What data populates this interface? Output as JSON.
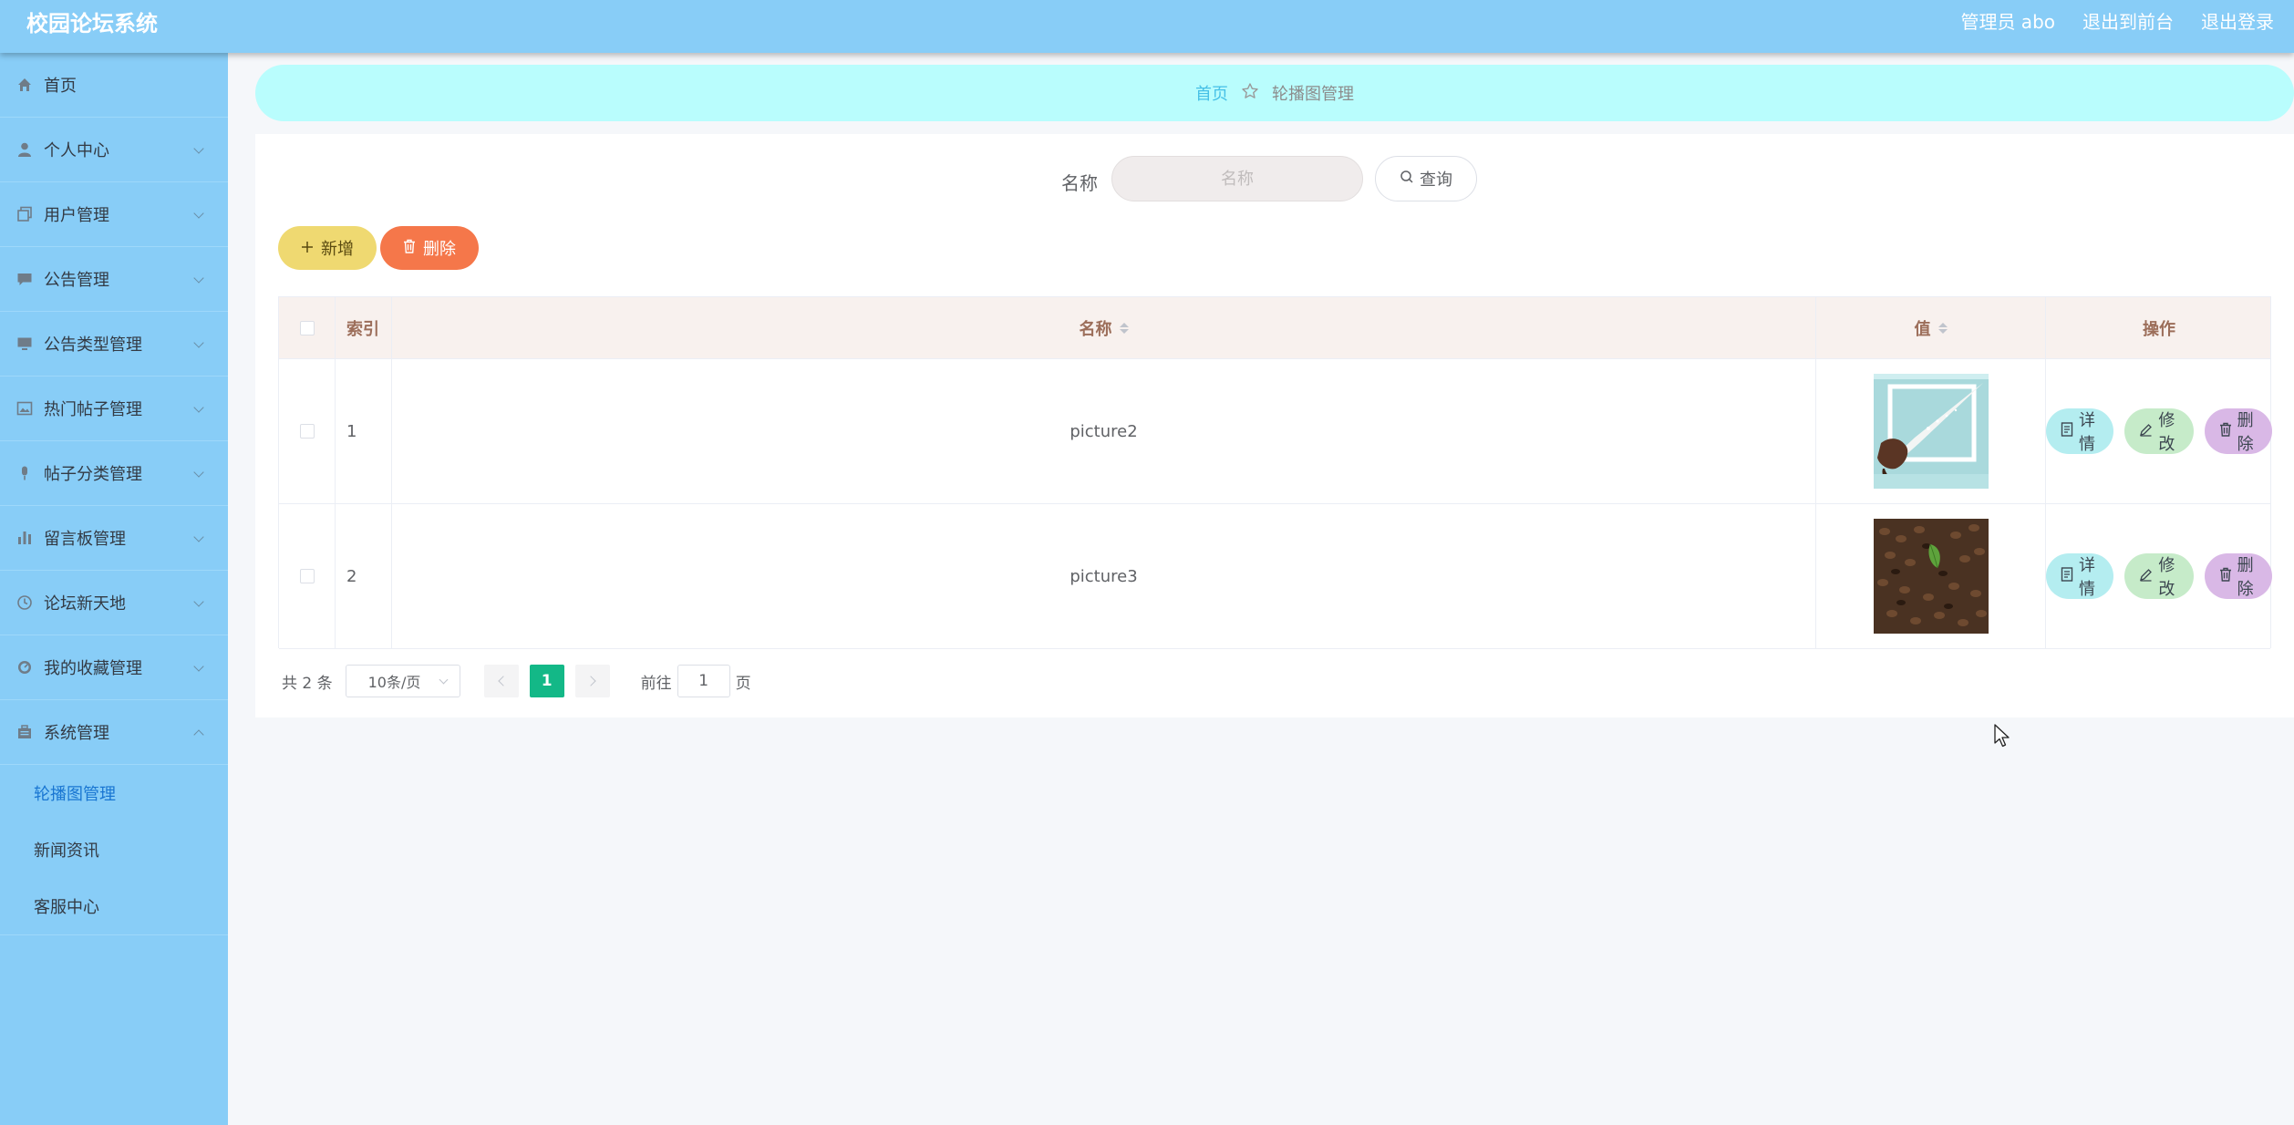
{
  "header": {
    "title": "校园论坛系统",
    "admin_label": "管理员 abo",
    "exit_front": "退出到前台",
    "logout": "退出登录"
  },
  "sidebar": {
    "items": [
      {
        "label": "首页",
        "icon": "home-icon"
      },
      {
        "label": "个人中心",
        "icon": "user-icon"
      },
      {
        "label": "用户管理",
        "icon": "copy-icon"
      },
      {
        "label": "公告管理",
        "icon": "chat-icon"
      },
      {
        "label": "公告类型管理",
        "icon": "monitor-icon"
      },
      {
        "label": "热门帖子管理",
        "icon": "picture-icon"
      },
      {
        "label": "帖子分类管理",
        "icon": "microphone-icon"
      },
      {
        "label": "留言板管理",
        "icon": "bar-chart-icon"
      },
      {
        "label": "论坛新天地",
        "icon": "clock-icon"
      },
      {
        "label": "我的收藏管理",
        "icon": "gauge-icon"
      },
      {
        "label": "系统管理",
        "icon": "suitcase-icon"
      }
    ],
    "sub_items": [
      "轮播图管理",
      "新闻资讯",
      "客服中心"
    ]
  },
  "breadcrumb": {
    "home": "首页",
    "current": "轮播图管理"
  },
  "search": {
    "label": "名称",
    "placeholder": "名称",
    "button": "查询"
  },
  "actions": {
    "add": "新增",
    "delete": "删除"
  },
  "table": {
    "headers": {
      "index": "索引",
      "name": "名称",
      "value": "值",
      "ops": "操作"
    },
    "rows": [
      {
        "index": "1",
        "name": "picture2"
      },
      {
        "index": "2",
        "name": "picture3"
      }
    ],
    "op_labels": {
      "detail": "详情",
      "edit": "修改",
      "delete": "删除"
    }
  },
  "pagination": {
    "total": "共 2 条",
    "page_size": "10条/页",
    "current_page": "1",
    "goto_label": "前往",
    "goto_value": "1",
    "page_suffix": "页"
  },
  "colors": {
    "topbar": "#88cdf7",
    "breadcrumb_bg": "#b9fdfd",
    "add_button": "#efd971",
    "delete_button": "#f5774a",
    "pager_active": "#13b887",
    "detail_button": "#b4edf0",
    "edit_button": "#c6ebc9",
    "row_delete_button": "#d9b8e6"
  }
}
